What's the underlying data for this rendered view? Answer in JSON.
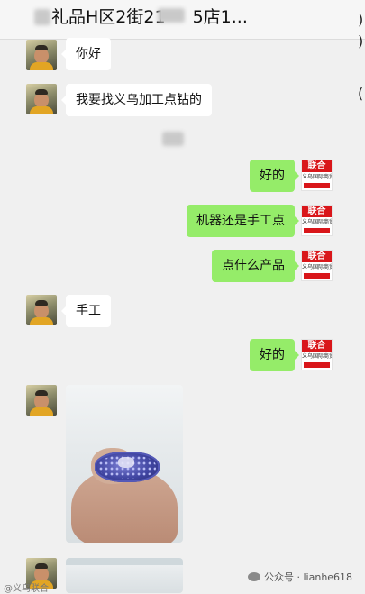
{
  "header": {
    "title": "礼品H区2街21",
    "title_tail": "5店1..."
  },
  "side_glyphs": [
    ")",
    ")",
    "("
  ],
  "messages": [
    {
      "side": "in",
      "text": "你好"
    },
    {
      "side": "in",
      "text": "我要找义乌加工点钻的"
    },
    {
      "side": "out",
      "text": "好的"
    },
    {
      "side": "out",
      "text": "机器还是手工点"
    },
    {
      "side": "out",
      "text": "点什么产品"
    },
    {
      "side": "in",
      "text": "手工"
    },
    {
      "side": "out",
      "text": "好的"
    },
    {
      "side": "in",
      "type": "image",
      "subject": "hand-with-blue-rhinestone-ring"
    },
    {
      "side": "in",
      "type": "image",
      "subject": "photo-partial"
    }
  ],
  "merchant_logo": {
    "brand": "联合",
    "line": "义乌国际商贸城",
    "colors": {
      "primary": "#d9161a",
      "secondary": "#ffffff"
    }
  },
  "watermark": {
    "text": "公众号 · lianhe618",
    "icon": "wechat-icon"
  },
  "corner_mark": "@义乌联合",
  "colors": {
    "background": "#f0f0f0",
    "incoming_bubble": "#ffffff",
    "outgoing_bubble": "#95ec69"
  }
}
